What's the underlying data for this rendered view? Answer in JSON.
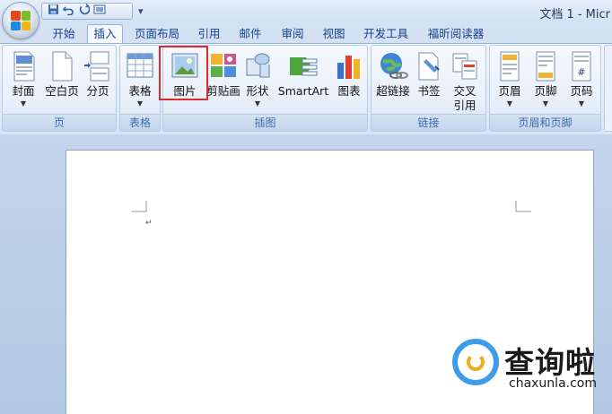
{
  "window": {
    "title": "文档 1 - Micr"
  },
  "quick_access": {
    "icons": [
      "save-icon",
      "undo-icon",
      "redo-icon",
      "print-preview-icon"
    ]
  },
  "tabs": [
    {
      "label": "开始"
    },
    {
      "label": "插入",
      "active": true
    },
    {
      "label": "页面布局"
    },
    {
      "label": "引用"
    },
    {
      "label": "邮件"
    },
    {
      "label": "审阅"
    },
    {
      "label": "视图"
    },
    {
      "label": "开发工具"
    },
    {
      "label": "福昕阅读器"
    }
  ],
  "ribbon": {
    "groups": [
      {
        "label": "页",
        "buttons": [
          "封面",
          "空白页",
          "分页"
        ]
      },
      {
        "label": "表格",
        "buttons": [
          "表格"
        ]
      },
      {
        "label": "插图",
        "buttons": [
          "图片",
          "剪贴画",
          "形状",
          "SmartArt",
          "图表"
        ]
      },
      {
        "label": "链接",
        "buttons": [
          "超链接",
          "书签",
          "交叉",
          "引用"
        ]
      },
      {
        "label": "页眉和页脚",
        "buttons": [
          "页眉",
          "页脚",
          "页码"
        ]
      }
    ],
    "highlighted_button": "图片"
  },
  "document": {
    "paragraph_mark": "↵"
  },
  "watermark": {
    "title": "查询啦",
    "url": "chaxunla.com"
  },
  "colors": {
    "highlight": "#e02a2a",
    "tab_text": "#15428b",
    "ribbon_label": "#3e6aaa"
  }
}
